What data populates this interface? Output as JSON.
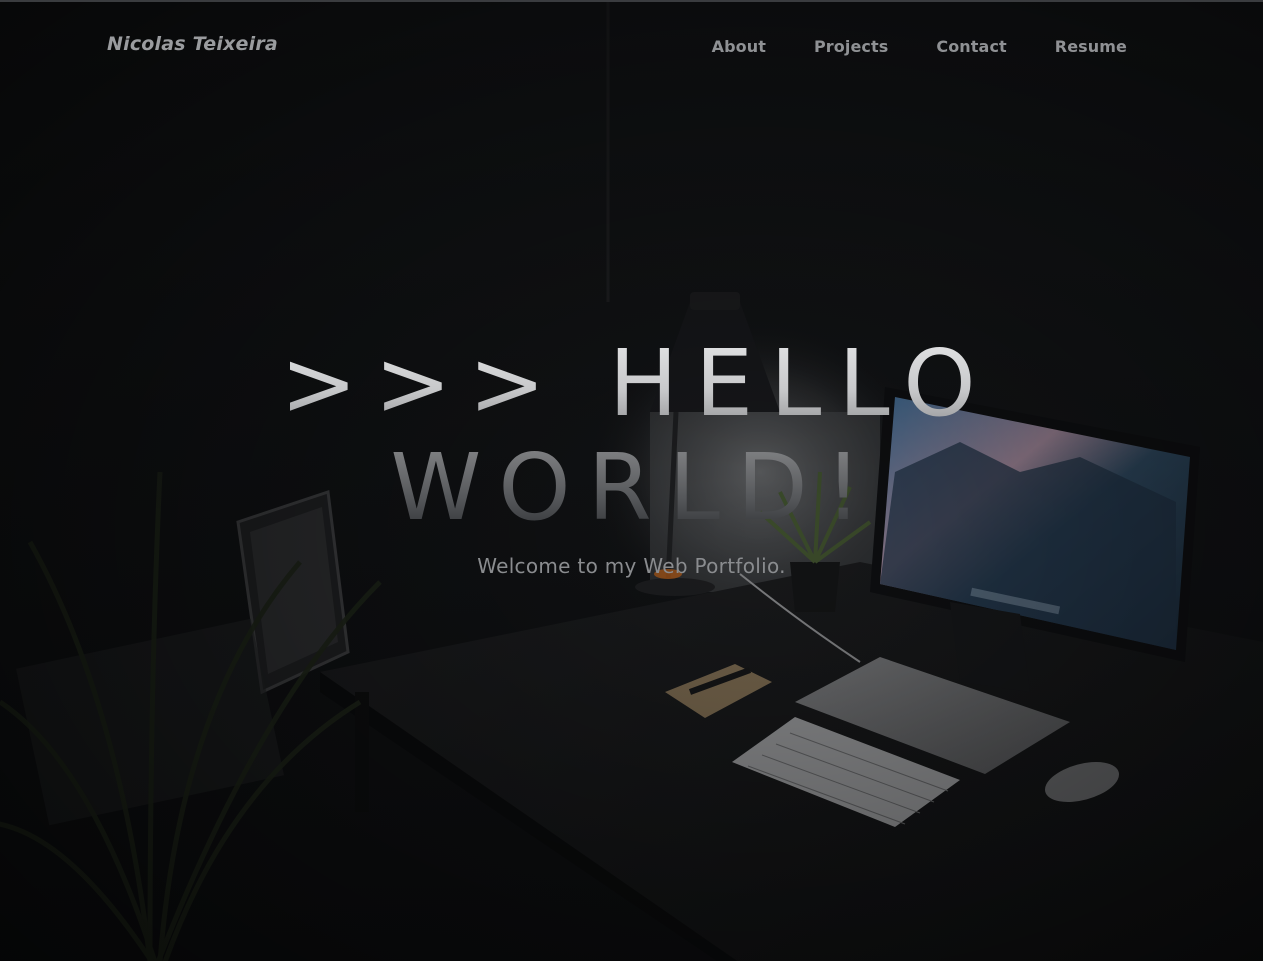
{
  "navbar": {
    "brand": "Nicolas Teixeira",
    "links": [
      {
        "label": "About"
      },
      {
        "label": "Projects"
      },
      {
        "label": "Contact"
      },
      {
        "label": "Resume"
      }
    ]
  },
  "hero": {
    "line1": ">>> HELLO",
    "line2": "WORLD!",
    "subtitle": "Welcome to my Web Portfolio."
  },
  "background": {
    "description_icon": "dark-desk-workspace-photo",
    "accent_colors": {
      "page_bg": "#101214",
      "monitor_sky": "#4f7fa8",
      "monitor_clouds": "#c98f9e",
      "lamp_glow": "#c9c9c9",
      "plant_green": "#2f3a22"
    }
  }
}
